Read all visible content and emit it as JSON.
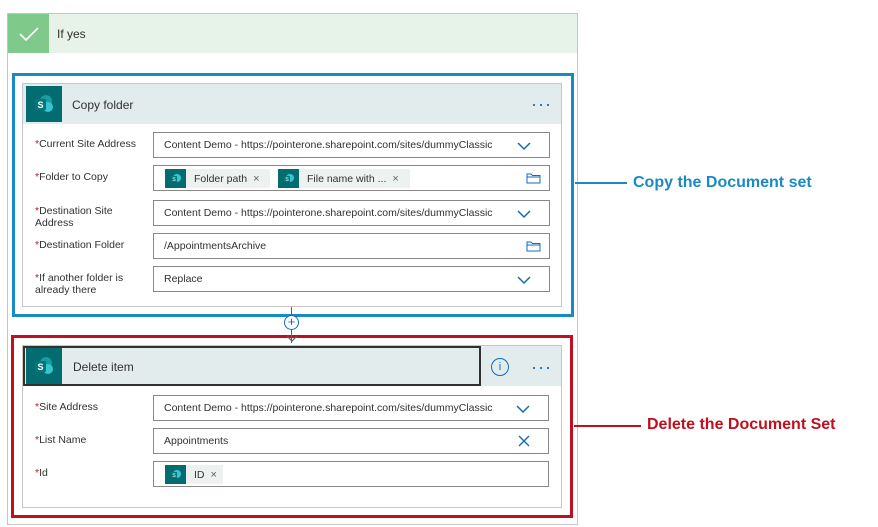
{
  "if_yes": {
    "title": "If yes"
  },
  "copy_folder": {
    "title": "Copy folder",
    "more": "···",
    "fields": {
      "current_site": {
        "label": "Current Site Address",
        "value": "Content Demo - https://pointerone.sharepoint.com/sites/dummyClassic"
      },
      "folder_to_copy": {
        "label": "Folder to Copy",
        "tokens": [
          "Folder path",
          "File name with ..."
        ]
      },
      "destination_site": {
        "label_line1": "Destination Site",
        "label_line2": "Address",
        "value": "Content Demo - https://pointerone.sharepoint.com/sites/dummyClassic"
      },
      "destination_folder": {
        "label": "Destination Folder",
        "value": "/AppointmentsArchive"
      },
      "if_exists": {
        "label_line1": "If another folder is",
        "label_line2": "already there",
        "value": "Replace"
      }
    }
  },
  "delete_item": {
    "title": "Delete item",
    "info": "i",
    "more": "···",
    "fields": {
      "site_address": {
        "label": "Site Address",
        "value": "Content Demo - https://pointerone.sharepoint.com/sites/dummyClassic"
      },
      "list_name": {
        "label": "List Name",
        "value": "Appointments"
      },
      "id": {
        "label": "Id",
        "tokens": [
          "ID"
        ]
      }
    }
  },
  "annotations": {
    "copy": {
      "text": "Copy the Document set",
      "color": "#1a8ac6"
    },
    "delete": {
      "text": "Delete the Document Set",
      "color": "#c0101f"
    }
  },
  "required_mark": "*",
  "token_remove": "×",
  "colors": {
    "accent": "#0f6cbd",
    "sharepoint": "#036c70",
    "success": "#7fc98a"
  }
}
